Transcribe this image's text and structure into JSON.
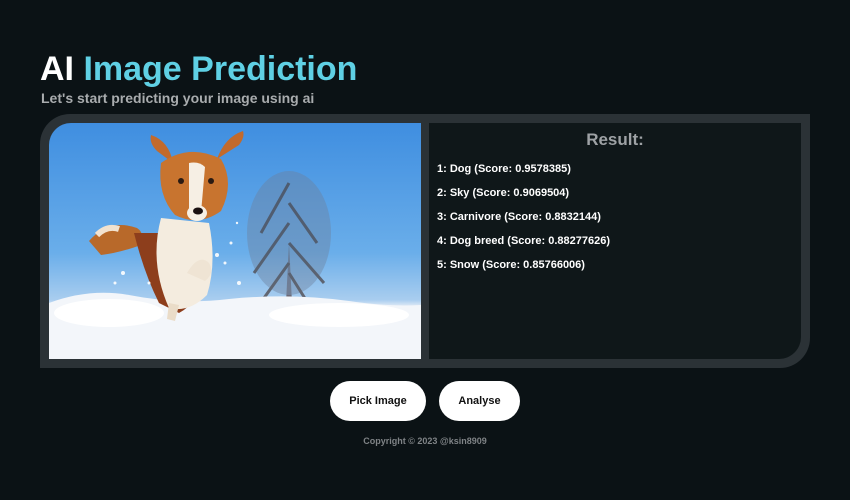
{
  "header": {
    "title_part1": "AI",
    "title_part2": "Image Prediction",
    "subtitle": "Let's start predicting your image using ai"
  },
  "image": {
    "name": "dog-in-snow-photo"
  },
  "result": {
    "title": "Result:",
    "items": [
      "1: Dog (Score: 0.9578385)",
      "2: Sky (Score: 0.9069504)",
      "3: Carnivore (Score: 0.8832144)",
      "4: Dog breed (Score: 0.88277626)",
      "5: Snow (Score: 0.85766006)"
    ]
  },
  "actions": {
    "pick_label": "Pick Image",
    "analyse_label": "Analyse"
  },
  "footer": {
    "copyright": "Copyright © 2023 @ksin8909"
  },
  "colors": {
    "background": "#0b1215",
    "accent": "#5fd0e4",
    "panel_border": "#2b3236",
    "result_bg": "#0f1719"
  }
}
